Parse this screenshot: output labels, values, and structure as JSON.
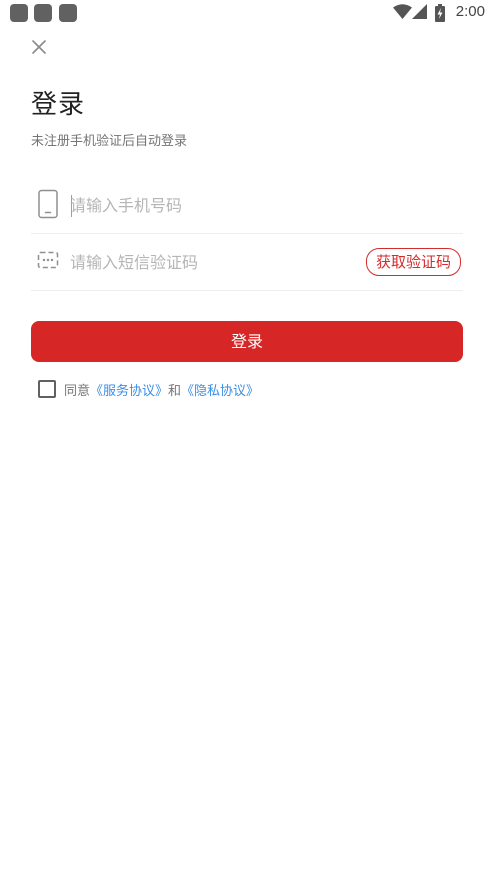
{
  "status_bar": {
    "time": "2:00",
    "notification_icons": [
      "app-notification-icon",
      "app-notification-icon",
      "app-notification-icon"
    ],
    "icons": [
      "wifi-icon",
      "signal-icon",
      "battery-charging-icon"
    ]
  },
  "close_icon": "close-icon",
  "title": "登录",
  "subtitle": "未注册手机验证后自动登录",
  "phone": {
    "icon": "phone-icon",
    "placeholder": "请输入手机号码",
    "value": ""
  },
  "code": {
    "icon": "message-icon",
    "placeholder": "请输入短信验证码",
    "value": "",
    "button_label": "获取验证码"
  },
  "login_button_label": "登录",
  "agreement": {
    "prefix": "同意",
    "service_link": "《服务协议》",
    "conjunction": "和",
    "privacy_link": "《隐私协议》",
    "checked": false
  },
  "colors": {
    "primary": "#d72626",
    "link": "#3a8ee6"
  }
}
